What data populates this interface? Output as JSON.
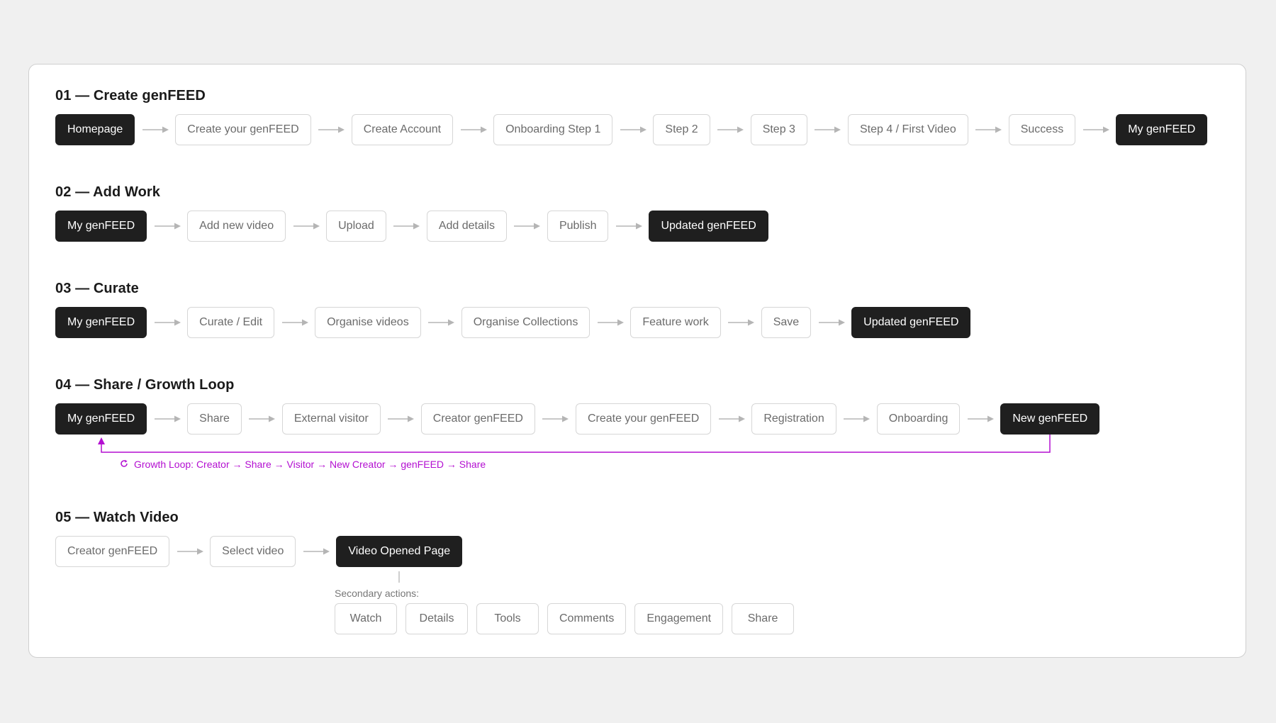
{
  "sections": [
    {
      "title": "01 — Create genFEED",
      "nodes": [
        {
          "label": "Homepage",
          "dark": true
        },
        {
          "label": "Create your genFEED",
          "dark": false
        },
        {
          "label": "Create Account",
          "dark": false
        },
        {
          "label": "Onboarding Step 1",
          "dark": false
        },
        {
          "label": "Step 2",
          "dark": false
        },
        {
          "label": "Step 3",
          "dark": false
        },
        {
          "label": "Step 4 / First Video",
          "dark": false
        },
        {
          "label": "Success",
          "dark": false
        },
        {
          "label": "My genFEED",
          "dark": true
        }
      ]
    },
    {
      "title": "02 — Add Work",
      "nodes": [
        {
          "label": "My genFEED",
          "dark": true
        },
        {
          "label": "Add new video",
          "dark": false
        },
        {
          "label": "Upload",
          "dark": false
        },
        {
          "label": "Add details",
          "dark": false
        },
        {
          "label": "Publish",
          "dark": false
        },
        {
          "label": "Updated genFEED",
          "dark": true
        }
      ]
    },
    {
      "title": "03 — Curate",
      "nodes": [
        {
          "label": "My genFEED",
          "dark": true
        },
        {
          "label": "Curate / Edit",
          "dark": false
        },
        {
          "label": "Organise videos",
          "dark": false
        },
        {
          "label": "Organise Collections",
          "dark": false
        },
        {
          "label": "Feature work",
          "dark": false
        },
        {
          "label": "Save",
          "dark": false
        },
        {
          "label": "Updated genFEED",
          "dark": true
        }
      ]
    },
    {
      "title": "04 — Share / Growth Loop",
      "nodes": [
        {
          "label": "My genFEED",
          "dark": true
        },
        {
          "label": "Share",
          "dark": false
        },
        {
          "label": "External visitor",
          "dark": false
        },
        {
          "label": "Creator genFEED",
          "dark": false
        },
        {
          "label": "Create your genFEED",
          "dark": false
        },
        {
          "label": "Registration",
          "dark": false
        },
        {
          "label": "Onboarding",
          "dark": false
        },
        {
          "label": "New genFEED",
          "dark": true
        }
      ]
    },
    {
      "title": "05 — Watch Video",
      "nodes": [
        {
          "label": "Creator genFEED",
          "dark": false
        },
        {
          "label": "Select video",
          "dark": false
        },
        {
          "label": "Video Opened Page",
          "dark": true
        }
      ]
    }
  ],
  "growth_loop": {
    "icon": "refresh-icon",
    "text": "Growth Loop: Creator → Share → Visitor → New Creator → genFEED → Share",
    "color": "#b30fd1"
  },
  "secondary": {
    "label": "Secondary actions:",
    "actions": [
      "Watch",
      "Details",
      "Tools",
      "Comments",
      "Engagement",
      "Share"
    ]
  },
  "colors": {
    "dark_node": "#1f1f1f",
    "light_border": "#d6d6d6",
    "arrow": "#b5b5b5",
    "loop": "#b30fd1"
  }
}
